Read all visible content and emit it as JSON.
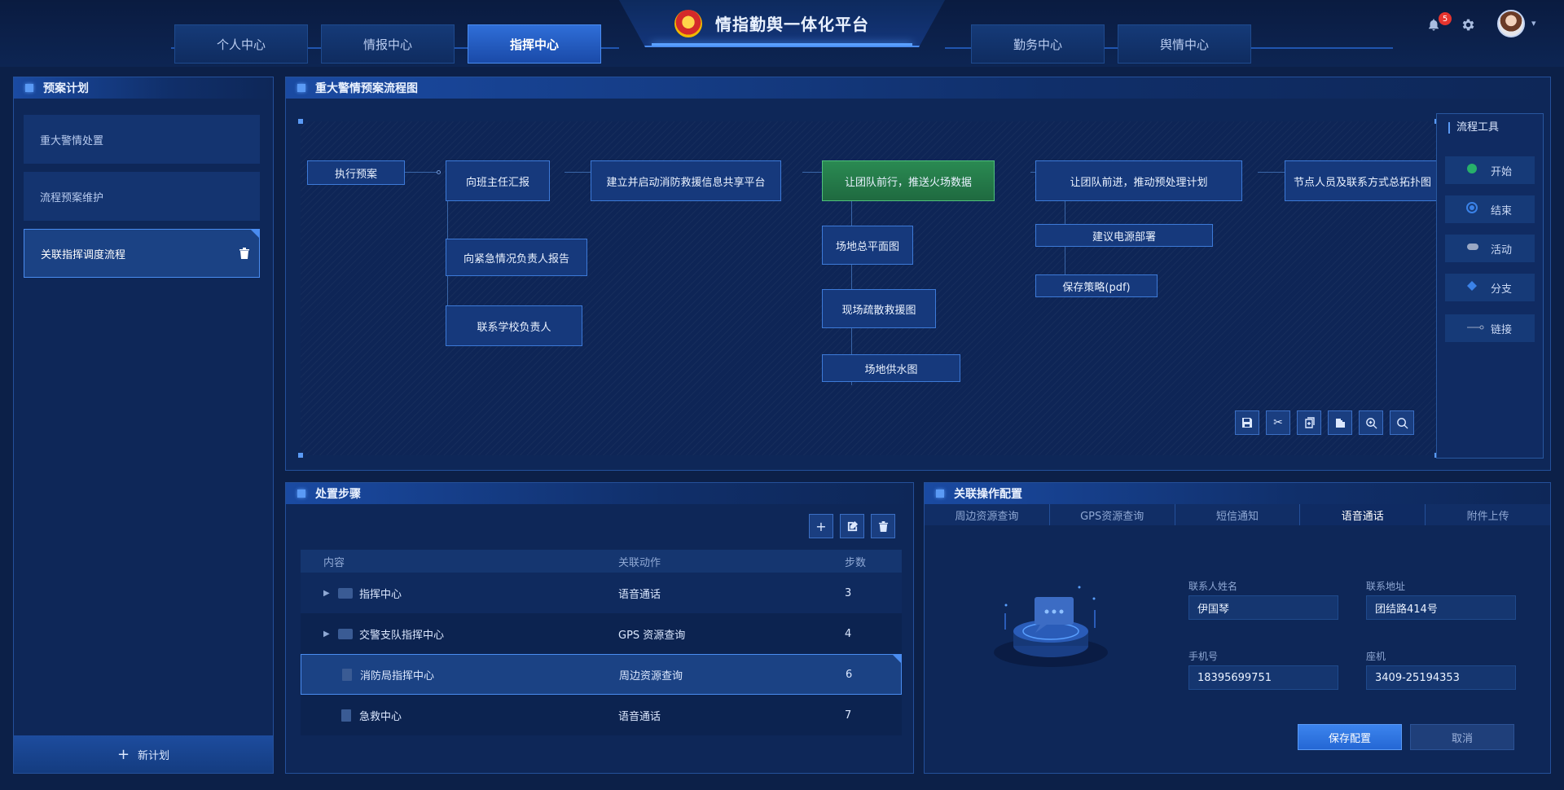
{
  "header": {
    "app_title": "情指勤舆一体化平台",
    "nav_tabs": [
      "个人中心",
      "情报中心",
      "指挥中心",
      "勤务中心",
      "舆情中心"
    ],
    "active_tab": "指挥中心",
    "notification_count": "5"
  },
  "plan_panel": {
    "title": "预案计划",
    "items": [
      "重大警情处置",
      "流程预案维护",
      "关联指挥调度流程"
    ],
    "new_plan_label": "新计划"
  },
  "flow_panel": {
    "title": "重大警情预案流程图",
    "nodes": {
      "n1": "执行预案",
      "n2": "向班主任汇报",
      "n3": "向紧急情况负责人报告",
      "n4": "联系学校负责人",
      "n5": "建立并启动消防救援信息共享平台",
      "n6": "让团队前行，推送火场数据",
      "n7": "场地总平面图",
      "n8": "现场疏散救援图",
      "n9": "场地供水图",
      "n10": "让团队前进，推动预处理计划",
      "n11": "建议电源部署",
      "n12": "保存策略(pdf)",
      "n13": "节点人员及联系方式总拓扑图"
    },
    "tools": {
      "title": "流程工具",
      "items": [
        "开始",
        "结束",
        "活动",
        "分支",
        "链接"
      ]
    }
  },
  "steps_panel": {
    "title": "处置步骤",
    "columns": [
      "内容",
      "关联动作",
      "步数"
    ],
    "rows": [
      {
        "content": "指挥中心",
        "action": "语音通话",
        "steps": "3"
      },
      {
        "content": "交警支队指挥中心",
        "action": "GPS 资源查询",
        "steps": "4"
      },
      {
        "content": "消防局指挥中心",
        "action": "周边资源查询",
        "steps": "6"
      },
      {
        "content": "急救中心",
        "action": "语音通话",
        "steps": "7"
      }
    ]
  },
  "config_panel": {
    "title": "关联操作配置",
    "tabs": [
      "周边资源查询",
      "GPS资源查询",
      "短信通知",
      "语音通话",
      "附件上传"
    ],
    "active_tab": "语音通话",
    "fields": {
      "contact_name_label": "联系人姓名",
      "contact_name": "伊国琴",
      "address_label": "联系地址",
      "address": "团结路414号",
      "mobile_label": "手机号",
      "mobile": "18395699751",
      "landline_label": "座机",
      "landline": "3409-25194353"
    },
    "save_label": "保存配置",
    "cancel_label": "取消"
  },
  "colors": {
    "background": "#0c2048",
    "panel": "#0e2758",
    "accent": "#4a8cf0",
    "highlight_node": "#2a8a52",
    "badge": "#e6342e"
  }
}
